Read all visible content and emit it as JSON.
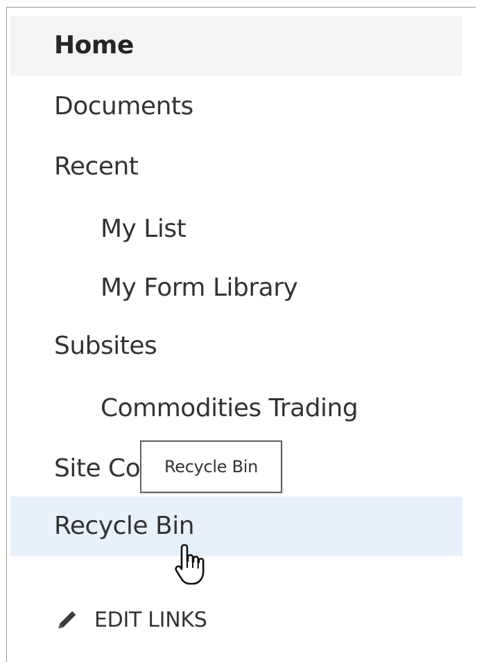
{
  "nav": {
    "items": [
      {
        "label": "Home"
      },
      {
        "label": "Documents"
      },
      {
        "label": "Recent"
      },
      {
        "label": "My List"
      },
      {
        "label": "My Form Library"
      },
      {
        "label": "Subsites"
      },
      {
        "label": "Commodities Trading"
      },
      {
        "label": "Site Contents"
      },
      {
        "label": "Recycle Bin"
      }
    ]
  },
  "tooltip": {
    "text": "Recycle Bin"
  },
  "edit_links": {
    "label": "EDIT LINKS",
    "icon": "pencil-icon"
  },
  "colors": {
    "selected_bg": "#f4f4f4",
    "hover_bg": "#e7f1fb",
    "text": "#333333"
  }
}
